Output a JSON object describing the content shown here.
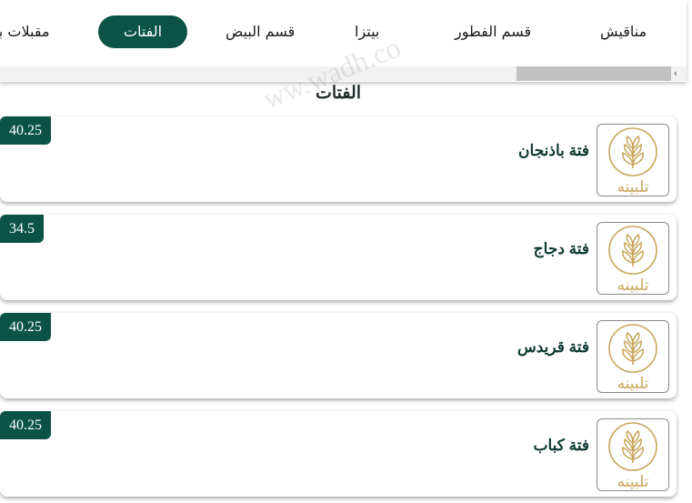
{
  "nav": {
    "tabs": [
      {
        "label": "مناقيش",
        "active": false
      },
      {
        "label": "قسم الفطور",
        "active": false
      },
      {
        "label": "بيتزا",
        "active": false
      },
      {
        "label": "قسم البيض",
        "active": false
      },
      {
        "label": "الفتات",
        "active": true
      },
      {
        "label": "مقبلات با",
        "active": false
      }
    ],
    "scroll_arrow": "‹"
  },
  "section": {
    "title": "الفتات"
  },
  "watermark": "ww.wadh.co",
  "brand": {
    "logo_text": "تلبينه",
    "accent_color": "#0b5445",
    "logo_color": "#c9a55a"
  },
  "items": [
    {
      "name": "فتة باذنجان",
      "price": "40.25"
    },
    {
      "name": "فتة دجاج",
      "price": "34.5"
    },
    {
      "name": "فتة قريدس",
      "price": "40.25"
    },
    {
      "name": "فتة كباب",
      "price": "40.25"
    }
  ]
}
